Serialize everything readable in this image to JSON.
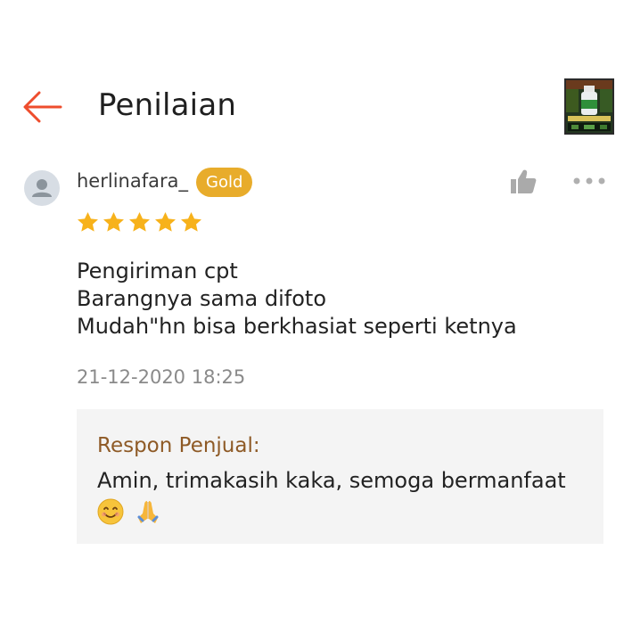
{
  "header": {
    "title": "Penilaian",
    "back_icon": "arrow-left-icon",
    "accent_color": "#ee4d2d"
  },
  "review": {
    "username": "herlinafara_",
    "badge": "Gold",
    "badge_color": "#e8ac2b",
    "rating": 5,
    "rating_max": 5,
    "star_color": "#f7b21b",
    "lines": [
      "Pengiriman cpt",
      "Barangnya sama difoto",
      "Mudah\"hn bisa berkhasiat seperti ketnya"
    ],
    "timestamp": "21-12-2020 18:25"
  },
  "actions": {
    "like_icon": "thumbs-up-icon",
    "more_icon": "more-dots-icon"
  },
  "seller_reply": {
    "label": "Respon Penjual:",
    "text": "Amin, trimakasih kaka, semoga bermanfaat",
    "emojis": [
      "smiling-face-icon",
      "folded-hands-icon"
    ]
  }
}
